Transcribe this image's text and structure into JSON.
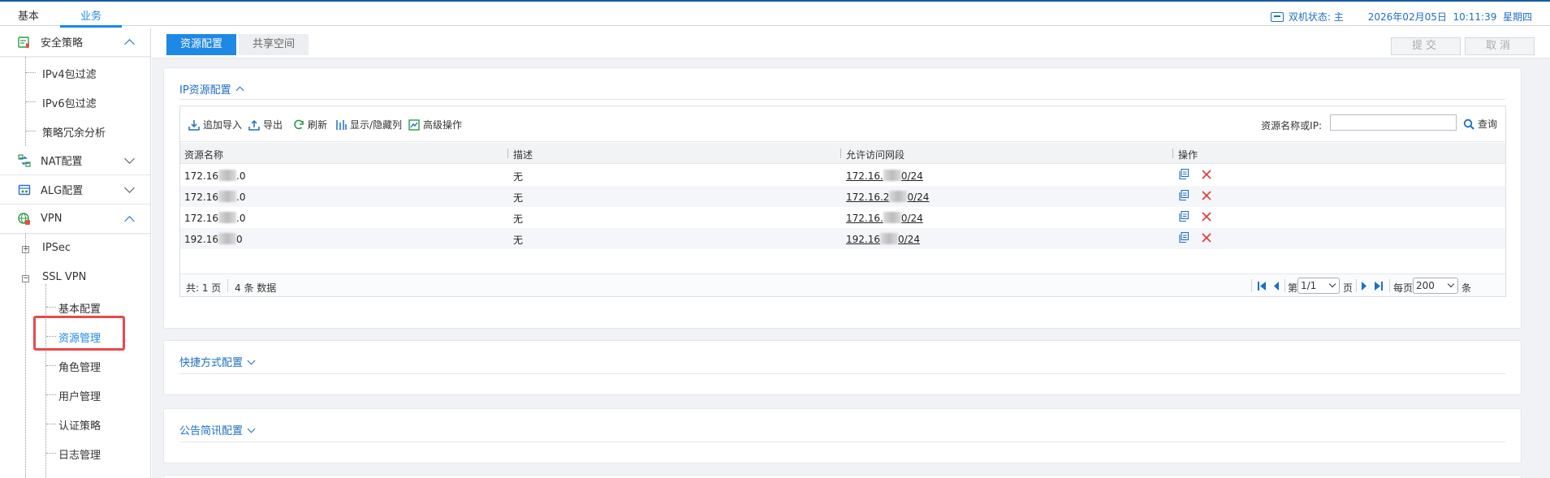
{
  "top": {
    "tabs": [
      "基本",
      "业务"
    ],
    "active_tab": "业务",
    "ha_status": "双机状态: 主",
    "datetime": "2026年02月05日  10:11:39  星期四"
  },
  "sidebar": {
    "sections": [
      {
        "label": "安全策略",
        "icon": "shield-list-icon",
        "expanded": true
      },
      {
        "label": "NAT配置",
        "icon": "nat-icon",
        "expanded": false
      },
      {
        "label": "ALG配置",
        "icon": "alg-icon",
        "expanded": false
      },
      {
        "label": "VPN",
        "icon": "vpn-globe-icon",
        "expanded": true
      }
    ],
    "security_items": [
      "IPv4包过滤",
      "IPv6包过滤",
      "策略冗余分析"
    ],
    "vpn_items": [
      "IPSec",
      "SSL VPN"
    ],
    "ssl_items": [
      "基本配置",
      "资源管理",
      "角色管理",
      "用户管理",
      "认证策略",
      "日志管理"
    ],
    "selected": "资源管理"
  },
  "main": {
    "tabs": [
      "资源配置",
      "共享空间"
    ],
    "submit_label": "提交",
    "cancel_label": "取消",
    "ip_panel": {
      "title": "IP资源配置",
      "toolbar": {
        "add_import": "追加导入",
        "export": "导出",
        "refresh": "刷新",
        "toggle_cols": "显示/隐藏列",
        "advanced": "高级操作",
        "search_label": "资源名称或IP:",
        "search_value": "",
        "search_btn": "查询"
      },
      "columns": [
        "资源名称",
        "描述",
        "允许访问网段",
        "操作"
      ],
      "rows": [
        {
          "name_pre": "172.16",
          "name_post": ".0",
          "desc": "无",
          "net_pre": "172.16.",
          "net_post": "0/24"
        },
        {
          "name_pre": "172.16",
          "name_post": ".0",
          "desc": "无",
          "net_pre": "172.16.2",
          "net_post": "0/24"
        },
        {
          "name_pre": "172.16",
          "name_post": ".0",
          "desc": "无",
          "net_pre": "172.16.",
          "net_post": "0/24"
        },
        {
          "name_pre": "192.16",
          "name_post": "0",
          "desc": "无",
          "net_pre": "192.16",
          "net_post": "0/24"
        }
      ],
      "footer": {
        "pages": "共: 1 页",
        "count": "4 条 数据",
        "page_prefix": "第",
        "page_value": "1/1",
        "page_suffix": "页",
        "per_page_prefix": "每页",
        "per_page_value": "200",
        "per_page_suffix": "条"
      }
    },
    "shortcut_panel": {
      "title": "快捷方式配置"
    },
    "notice_panel": {
      "title": "公告简讯配置"
    }
  },
  "colors": {
    "accent": "#1e88e5",
    "highlight": "#e84a4a",
    "delete": "#e03a3a"
  }
}
